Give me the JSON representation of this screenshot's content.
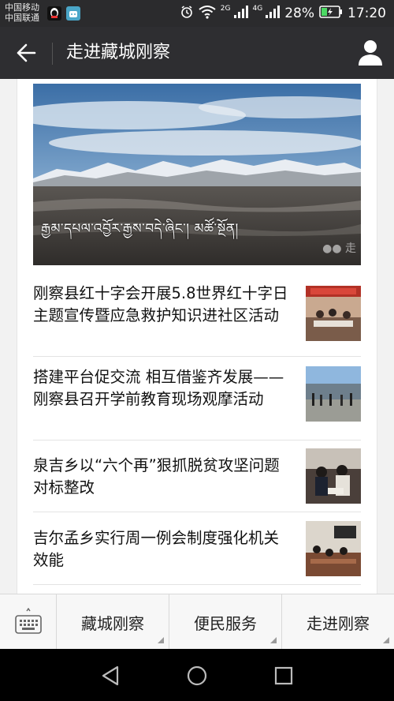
{
  "status_bar": {
    "carrier_1": "中国移动",
    "carrier_2": "中国联通",
    "net_2g": "2G",
    "net_4g": "4G",
    "battery": "28%",
    "time": "17:20"
  },
  "app_bar": {
    "title": "走进藏城刚察"
  },
  "hero": {
    "caption": "རྒྱམ་དཔལ་འབྱོར་རྒྱས་བདེ་ཞིང་། མཚོ་སྔོན།",
    "watermark": "●● 走"
  },
  "news": [
    {
      "title": "刚察县红十字会开展5.8世界红十字日 主题宣传暨应急救护知识进社区活动"
    },
    {
      "title": "搭建平台促交流 相互借鉴齐发展——刚察县召开学前教育现场观摩活动"
    },
    {
      "title": "泉吉乡以“六个再”狠抓脱贫攻坚问题对标整改"
    },
    {
      "title": "吉尔孟乡实行周一例会制度强化机关效能"
    }
  ],
  "bottom_menu": {
    "items": [
      "藏城刚察",
      "便民服务",
      "走进刚察"
    ]
  },
  "colors": {
    "status_bar": "#2b2b2d",
    "app_bar": "#2e2e31",
    "nav_bar": "#000000",
    "menu_bg": "#f7f7f7"
  }
}
